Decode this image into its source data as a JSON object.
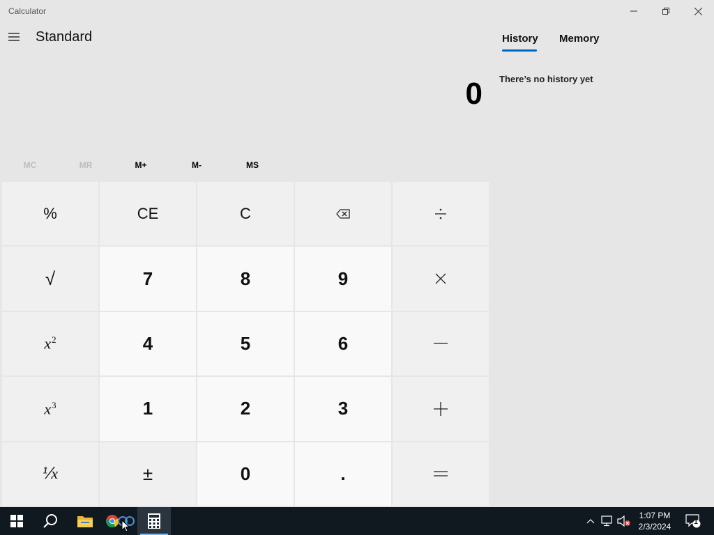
{
  "window": {
    "title": "Calculator"
  },
  "header": {
    "mode": "Standard"
  },
  "display": {
    "value": "0"
  },
  "memory": {
    "buttons": [
      {
        "label": "MC",
        "enabled": false
      },
      {
        "label": "MR",
        "enabled": false
      },
      {
        "label": "M+",
        "enabled": true
      },
      {
        "label": "M-",
        "enabled": true
      },
      {
        "label": "MS",
        "enabled": true
      }
    ]
  },
  "keypad": {
    "percent": "%",
    "ce": "CE",
    "c": "C",
    "sqrt": "√",
    "seven": "7",
    "eight": "8",
    "nine": "9",
    "square_base": "x",
    "square_exp": "2",
    "four": "4",
    "five": "5",
    "six": "6",
    "cube_base": "x",
    "cube_exp": "3",
    "one": "1",
    "two": "2",
    "three": "3",
    "reciprocal": "⅟x",
    "negate": "±",
    "zero": "0",
    "decimal": "."
  },
  "panel": {
    "tabs": [
      "History",
      "Memory"
    ],
    "active_tab": "History",
    "empty_message": "There’s no history yet"
  },
  "taskbar": {
    "time": "1:07 PM",
    "date": "2/3/2024",
    "notification_count": "1",
    "pinned": [
      "start-icon",
      "search-icon",
      "file-explorer-icon",
      "chrome-icon",
      "calculator-icon"
    ]
  },
  "colors": {
    "background": "#e6e6e6",
    "accent": "#0067c0",
    "operator_key": "#f0f0f0",
    "number_key": "#f9f9f9",
    "taskbar": "#101820"
  }
}
